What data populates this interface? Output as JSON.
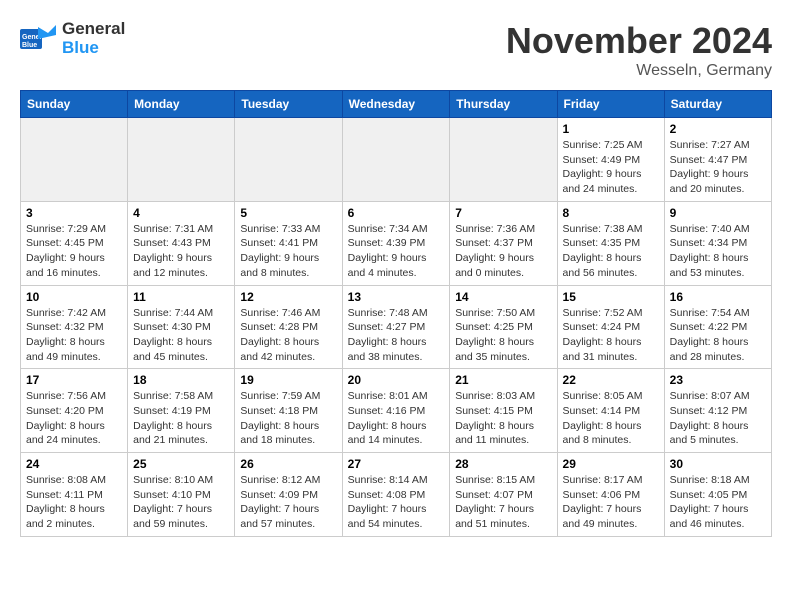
{
  "logo": {
    "line1": "General",
    "line2": "Blue"
  },
  "title": "November 2024",
  "subtitle": "Wesseln, Germany",
  "weekdays": [
    "Sunday",
    "Monday",
    "Tuesday",
    "Wednesday",
    "Thursday",
    "Friday",
    "Saturday"
  ],
  "weeks": [
    [
      {
        "day": "",
        "info": ""
      },
      {
        "day": "",
        "info": ""
      },
      {
        "day": "",
        "info": ""
      },
      {
        "day": "",
        "info": ""
      },
      {
        "day": "",
        "info": ""
      },
      {
        "day": "1",
        "info": "Sunrise: 7:25 AM\nSunset: 4:49 PM\nDaylight: 9 hours\nand 24 minutes."
      },
      {
        "day": "2",
        "info": "Sunrise: 7:27 AM\nSunset: 4:47 PM\nDaylight: 9 hours\nand 20 minutes."
      }
    ],
    [
      {
        "day": "3",
        "info": "Sunrise: 7:29 AM\nSunset: 4:45 PM\nDaylight: 9 hours\nand 16 minutes."
      },
      {
        "day": "4",
        "info": "Sunrise: 7:31 AM\nSunset: 4:43 PM\nDaylight: 9 hours\nand 12 minutes."
      },
      {
        "day": "5",
        "info": "Sunrise: 7:33 AM\nSunset: 4:41 PM\nDaylight: 9 hours\nand 8 minutes."
      },
      {
        "day": "6",
        "info": "Sunrise: 7:34 AM\nSunset: 4:39 PM\nDaylight: 9 hours\nand 4 minutes."
      },
      {
        "day": "7",
        "info": "Sunrise: 7:36 AM\nSunset: 4:37 PM\nDaylight: 9 hours\nand 0 minutes."
      },
      {
        "day": "8",
        "info": "Sunrise: 7:38 AM\nSunset: 4:35 PM\nDaylight: 8 hours\nand 56 minutes."
      },
      {
        "day": "9",
        "info": "Sunrise: 7:40 AM\nSunset: 4:34 PM\nDaylight: 8 hours\nand 53 minutes."
      }
    ],
    [
      {
        "day": "10",
        "info": "Sunrise: 7:42 AM\nSunset: 4:32 PM\nDaylight: 8 hours\nand 49 minutes."
      },
      {
        "day": "11",
        "info": "Sunrise: 7:44 AM\nSunset: 4:30 PM\nDaylight: 8 hours\nand 45 minutes."
      },
      {
        "day": "12",
        "info": "Sunrise: 7:46 AM\nSunset: 4:28 PM\nDaylight: 8 hours\nand 42 minutes."
      },
      {
        "day": "13",
        "info": "Sunrise: 7:48 AM\nSunset: 4:27 PM\nDaylight: 8 hours\nand 38 minutes."
      },
      {
        "day": "14",
        "info": "Sunrise: 7:50 AM\nSunset: 4:25 PM\nDaylight: 8 hours\nand 35 minutes."
      },
      {
        "day": "15",
        "info": "Sunrise: 7:52 AM\nSunset: 4:24 PM\nDaylight: 8 hours\nand 31 minutes."
      },
      {
        "day": "16",
        "info": "Sunrise: 7:54 AM\nSunset: 4:22 PM\nDaylight: 8 hours\nand 28 minutes."
      }
    ],
    [
      {
        "day": "17",
        "info": "Sunrise: 7:56 AM\nSunset: 4:20 PM\nDaylight: 8 hours\nand 24 minutes."
      },
      {
        "day": "18",
        "info": "Sunrise: 7:58 AM\nSunset: 4:19 PM\nDaylight: 8 hours\nand 21 minutes."
      },
      {
        "day": "19",
        "info": "Sunrise: 7:59 AM\nSunset: 4:18 PM\nDaylight: 8 hours\nand 18 minutes."
      },
      {
        "day": "20",
        "info": "Sunrise: 8:01 AM\nSunset: 4:16 PM\nDaylight: 8 hours\nand 14 minutes."
      },
      {
        "day": "21",
        "info": "Sunrise: 8:03 AM\nSunset: 4:15 PM\nDaylight: 8 hours\nand 11 minutes."
      },
      {
        "day": "22",
        "info": "Sunrise: 8:05 AM\nSunset: 4:14 PM\nDaylight: 8 hours\nand 8 minutes."
      },
      {
        "day": "23",
        "info": "Sunrise: 8:07 AM\nSunset: 4:12 PM\nDaylight: 8 hours\nand 5 minutes."
      }
    ],
    [
      {
        "day": "24",
        "info": "Sunrise: 8:08 AM\nSunset: 4:11 PM\nDaylight: 8 hours\nand 2 minutes."
      },
      {
        "day": "25",
        "info": "Sunrise: 8:10 AM\nSunset: 4:10 PM\nDaylight: 7 hours\nand 59 minutes."
      },
      {
        "day": "26",
        "info": "Sunrise: 8:12 AM\nSunset: 4:09 PM\nDaylight: 7 hours\nand 57 minutes."
      },
      {
        "day": "27",
        "info": "Sunrise: 8:14 AM\nSunset: 4:08 PM\nDaylight: 7 hours\nand 54 minutes."
      },
      {
        "day": "28",
        "info": "Sunrise: 8:15 AM\nSunset: 4:07 PM\nDaylight: 7 hours\nand 51 minutes."
      },
      {
        "day": "29",
        "info": "Sunrise: 8:17 AM\nSunset: 4:06 PM\nDaylight: 7 hours\nand 49 minutes."
      },
      {
        "day": "30",
        "info": "Sunrise: 8:18 AM\nSunset: 4:05 PM\nDaylight: 7 hours\nand 46 minutes."
      }
    ]
  ]
}
